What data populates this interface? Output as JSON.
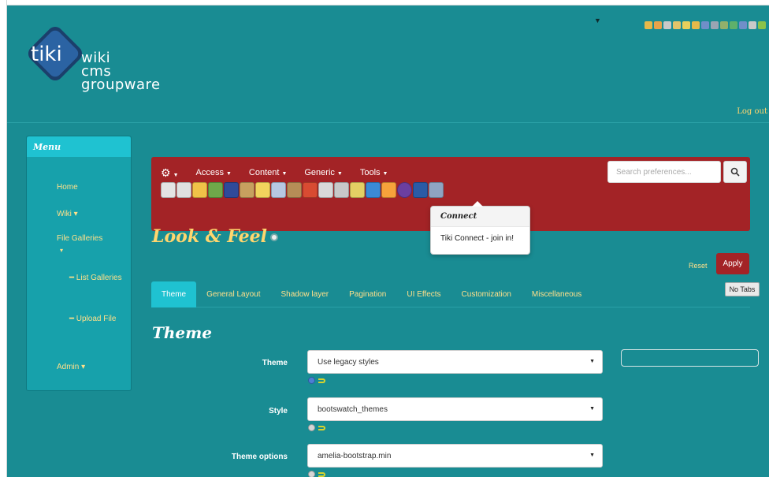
{
  "logo": {
    "mark_text": "tiki",
    "lines": [
      "wiki",
      "cms",
      "groupware"
    ]
  },
  "header": {
    "logout_label": "Log out"
  },
  "menu": {
    "title": "Menu",
    "items": [
      {
        "label": "Home"
      },
      {
        "label": "Wiki ▾"
      },
      {
        "label": "File Galleries"
      },
      {
        "label": "━ List Galleries"
      },
      {
        "label": "━ Upload File"
      },
      {
        "label": "Admin ▾"
      }
    ]
  },
  "adminbar": {
    "gear_label": "⚙",
    "nav": [
      {
        "label": "Access"
      },
      {
        "label": "Content"
      },
      {
        "label": "Generic"
      },
      {
        "label": "Tools"
      }
    ],
    "search_placeholder": "Search preferences...",
    "icon_colors": [
      "#e4e4e4",
      "#e0e0e0",
      "#f0c248",
      "#6fa84a",
      "#2f4a9a",
      "#c7a05f",
      "#f1d35d",
      "#b7c7e2",
      "#b68d57",
      "#d84b32",
      "#d9d9d9",
      "#c8c8c8",
      "#e4cf64",
      "#3b8ad6",
      "#f7a23b",
      "#6b3fa0",
      "#2b5ba6",
      "#8fa4c2"
    ]
  },
  "popover": {
    "title": "Connect",
    "body": "Tiki Connect - join in!"
  },
  "page": {
    "title": "Look & Feel",
    "reset_label": "Reset",
    "apply_label": "Apply",
    "notabs_label": "No Tabs",
    "tabs": [
      "Theme",
      "General Layout",
      "Shadow layer",
      "Pagination",
      "UI Effects",
      "Customization",
      "Miscellaneous"
    ],
    "section_title": "Theme",
    "fields": [
      {
        "label": "Theme",
        "value": "Use legacy styles"
      },
      {
        "label": "Style",
        "value": "bootswatch_themes"
      },
      {
        "label": "Theme options",
        "value": "amelia-bootstrap.min"
      }
    ]
  }
}
